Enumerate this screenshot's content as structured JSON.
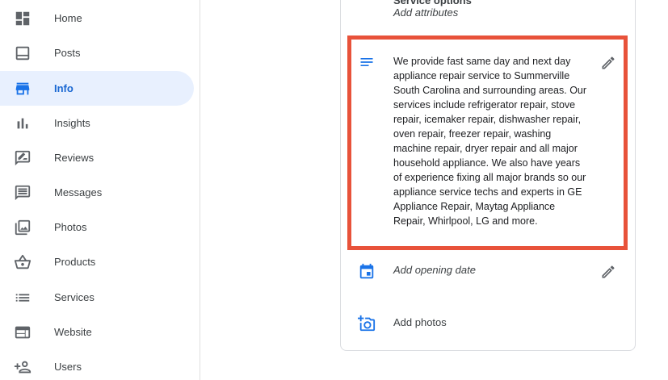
{
  "sidebar": {
    "items": [
      {
        "label": "Home",
        "icon": "dashboard-icon",
        "active": false
      },
      {
        "label": "Posts",
        "icon": "posts-icon",
        "active": false
      },
      {
        "label": "Info",
        "icon": "storefront-icon",
        "active": true
      },
      {
        "label": "Insights",
        "icon": "bar-chart-icon",
        "active": false
      },
      {
        "label": "Reviews",
        "icon": "rate-review-icon",
        "active": false
      },
      {
        "label": "Messages",
        "icon": "chat-icon",
        "active": false
      },
      {
        "label": "Photos",
        "icon": "photo-library-icon",
        "active": false
      },
      {
        "label": "Products",
        "icon": "basket-icon",
        "active": false
      },
      {
        "label": "Services",
        "icon": "list-icon",
        "active": false
      },
      {
        "label": "Website",
        "icon": "web-icon",
        "active": false
      },
      {
        "label": "Users",
        "icon": "person-add-icon",
        "active": false
      }
    ]
  },
  "info": {
    "attributes_header": "Service options",
    "attributes_link": "Add attributes",
    "description": "We provide fast same day and next day appliance repair service to Summerville South Carolina and surrounding areas. Our services include refrigerator repair, stove repair, icemaker repair, dishwasher repair, oven repair, freezer repair, washing machine repair, dryer repair and all major household appliance. We also have years of experience fixing all major brands so our appliance service techs and experts in GE Appliance Repair, Maytag Appliance Repair, Whirlpool, LG and more.",
    "opening_date_label": "Add opening date",
    "add_photos_label": "Add photos"
  },
  "colors": {
    "accent": "#1a73e8",
    "active_bg": "#e8f0fe",
    "highlight_border": "#e8523a"
  }
}
